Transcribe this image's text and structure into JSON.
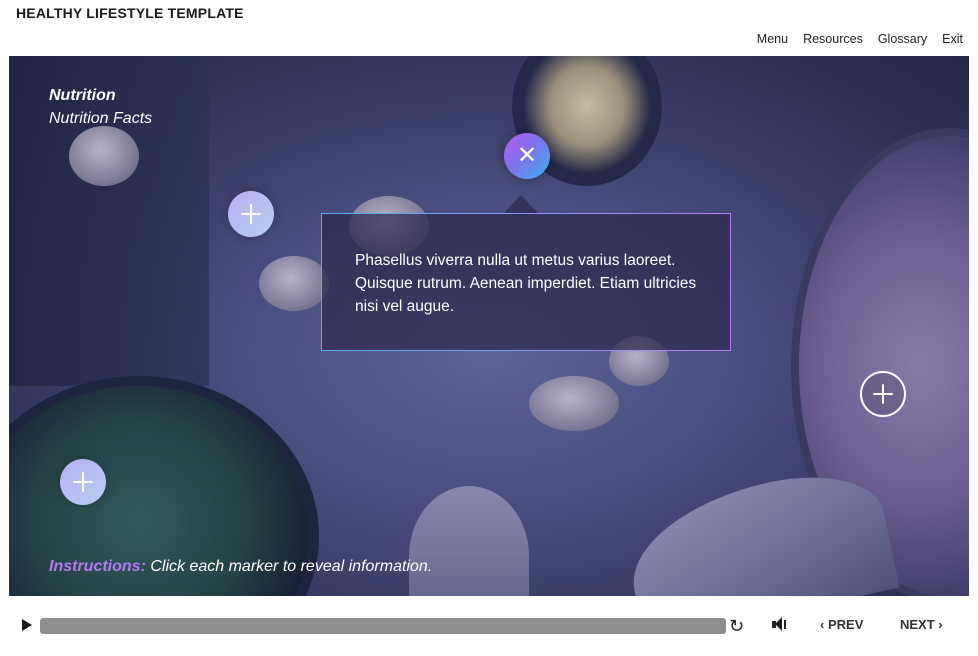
{
  "header": {
    "course_title": "HEALTHY LIFESTYLE TEMPLATE",
    "nav": [
      "Menu",
      "Resources",
      "Glossary",
      "Exit"
    ]
  },
  "slide": {
    "title": "Nutrition",
    "subtitle": "Nutrition Facts",
    "popup_text": "Phasellus viverra nulla ut metus varius laoreet. Quisque rutrum. Aenean imperdiet. Etiam ultricies nisi vel augue.",
    "instructions_label": "Instructions:",
    "instructions_text": " Click each marker to reveal information."
  },
  "player": {
    "prev_label": "PREV",
    "next_label": "NEXT",
    "icons": {
      "play": "play-icon",
      "replay": "replay-icon",
      "volume": "volume-icon",
      "prev": "chevron-left-icon",
      "next": "chevron-right-icon",
      "close": "close-icon",
      "marker": "plus-icon"
    }
  },
  "colors": {
    "accent_purple": "#b579f4",
    "marker_gradient_start": "#b7b0f2",
    "marker_gradient_end": "#b6cdf0",
    "active_marker_start": "#b25af0",
    "active_marker_end": "#3ab1ee",
    "seek_bar": "#8d8d8d"
  }
}
